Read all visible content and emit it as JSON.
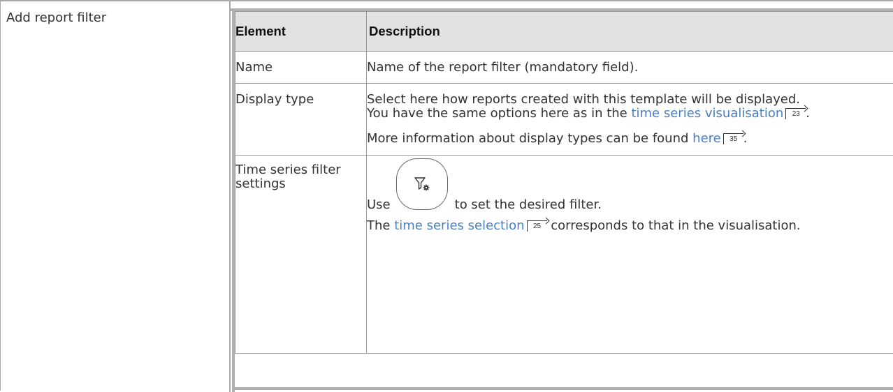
{
  "left_label": "Add report filter",
  "table": {
    "headers": [
      "Element",
      "Description"
    ],
    "rows": {
      "name": {
        "element": "Name",
        "desc": "Name of the report filter (mandatory field)."
      },
      "display_type": {
        "element": "Display type",
        "line1": "Select here how reports created with this template will be displayed.",
        "line2_pre": "You have the same options here as in the ",
        "line2_link": "time series visualisation",
        "line2_ref": "23",
        "line2_post": ".",
        "line3_pre": "More information about display types can be found ",
        "line3_link": "here",
        "line3_ref": "35",
        "line3_post": "."
      },
      "time_series": {
        "element": "Time series filter settings",
        "use_pre": "Use",
        "use_post": "to set the desired filter.",
        "filter_icon": "filter-settings-icon",
        "sel_pre": "The ",
        "sel_link": "time series selection",
        "sel_ref": "25",
        "sel_post": " corresponds to that in the visualisation."
      }
    }
  },
  "colors": {
    "link": "#4a7fc1",
    "header_bg": "#e2e2e2",
    "border": "#9a9a9a"
  }
}
